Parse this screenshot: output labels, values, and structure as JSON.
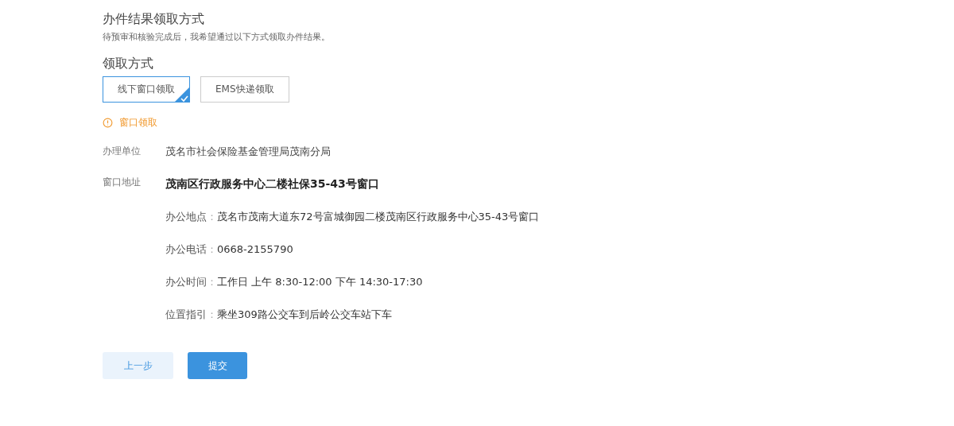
{
  "section_title": "办件结果领取方式",
  "description": "待预审和核验完成后，我希望通过以下方式领取办件结果。",
  "method_label": "领取方式",
  "options": [
    {
      "label": "线下窗口领取",
      "selected": true
    },
    {
      "label": "EMS快递领取",
      "selected": false
    }
  ],
  "notice": "窗口领取",
  "unit": {
    "label": "办理单位",
    "value": "茂名市社会保险基金管理局茂南分局"
  },
  "address": {
    "label": "窗口地址",
    "title": "茂南区行政服务中心二楼社保35-43号窗口",
    "separator": "：",
    "details": [
      {
        "label": "办公地点",
        "value": "茂名市茂南大道东72号富城御园二楼茂南区行政服务中心35-43号窗口"
      },
      {
        "label": "办公电话",
        "value": "0668-2155790"
      },
      {
        "label": "办公时间",
        "value": "工作日 上午 8:30-12:00 下午 14:30-17:30"
      },
      {
        "label": "位置指引",
        "value": "乘坐309路公交车到后岭公交车站下车"
      }
    ]
  },
  "buttons": [
    {
      "label": "上一步",
      "kind": "secondary"
    },
    {
      "label": "提交",
      "kind": "primary"
    }
  ]
}
